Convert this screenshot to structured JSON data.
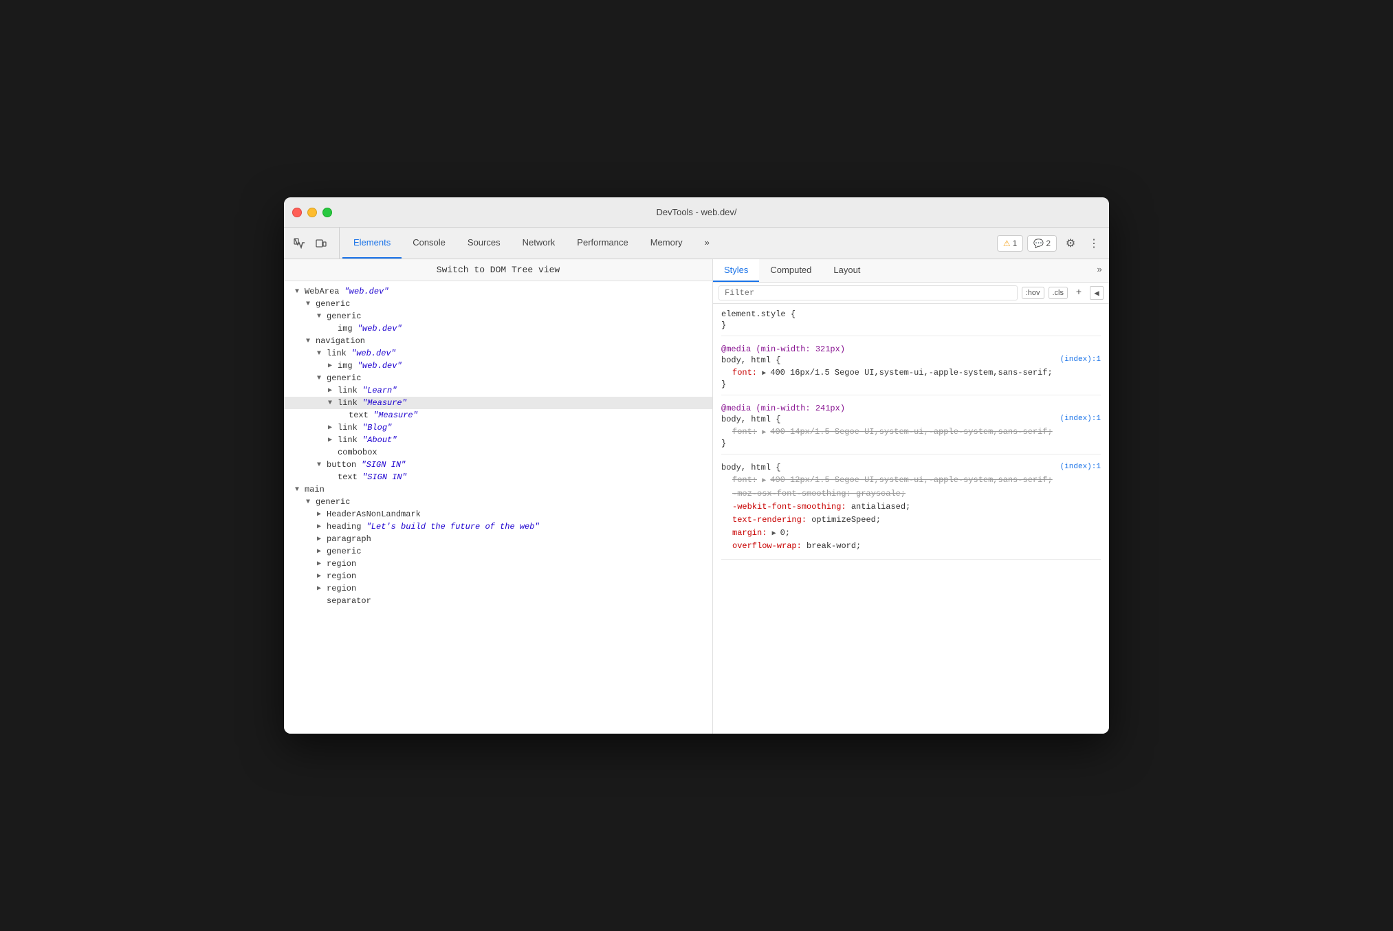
{
  "window": {
    "title": "DevTools - web.dev/"
  },
  "toolbar": {
    "tabs": [
      {
        "label": "Elements",
        "active": true
      },
      {
        "label": "Console",
        "active": false
      },
      {
        "label": "Sources",
        "active": false
      },
      {
        "label": "Network",
        "active": false
      },
      {
        "label": "Performance",
        "active": false
      },
      {
        "label": "Memory",
        "active": false
      }
    ],
    "more_label": "»",
    "warning_count": "1",
    "info_count": "2"
  },
  "dom_panel": {
    "switch_label": "Switch to DOM Tree view",
    "tree": [
      {
        "indent": 0,
        "arrow": "expanded",
        "label": "WebArea",
        "attr": "\"web.dev\""
      },
      {
        "indent": 1,
        "arrow": "expanded",
        "label": "generic"
      },
      {
        "indent": 2,
        "arrow": "expanded",
        "label": "generic"
      },
      {
        "indent": 3,
        "arrow": "leaf",
        "label": "img",
        "attr": "\"web.dev\""
      },
      {
        "indent": 1,
        "arrow": "expanded",
        "label": "navigation"
      },
      {
        "indent": 2,
        "arrow": "expanded",
        "label": "link",
        "attr": "\"web.dev\""
      },
      {
        "indent": 3,
        "arrow": "collapsed",
        "label": "img",
        "attr": "\"web.dev\""
      },
      {
        "indent": 2,
        "arrow": "expanded",
        "label": "generic"
      },
      {
        "indent": 3,
        "arrow": "collapsed",
        "label": "link",
        "attr": "\"Learn\""
      },
      {
        "indent": 3,
        "arrow": "expanded",
        "label": "link",
        "attr": "\"Measure\"",
        "selected": true
      },
      {
        "indent": 4,
        "arrow": "leaf",
        "label": "text",
        "attr": "\"Measure\""
      },
      {
        "indent": 3,
        "arrow": "collapsed",
        "label": "link",
        "attr": "\"Blog\""
      },
      {
        "indent": 3,
        "arrow": "collapsed",
        "label": "link",
        "attr": "\"About\""
      },
      {
        "indent": 3,
        "arrow": "leaf",
        "label": "combobox"
      },
      {
        "indent": 2,
        "arrow": "expanded",
        "label": "button",
        "attr": "\"SIGN IN\""
      },
      {
        "indent": 3,
        "arrow": "leaf",
        "label": "text",
        "attr": "\"SIGN IN\""
      },
      {
        "indent": 0,
        "arrow": "expanded",
        "label": "main"
      },
      {
        "indent": 1,
        "arrow": "expanded",
        "label": "generic"
      },
      {
        "indent": 2,
        "arrow": "collapsed",
        "label": "HeaderAsNonLandmark"
      },
      {
        "indent": 2,
        "arrow": "collapsed",
        "label": "heading",
        "attr": "\"Let's build the future of the web\""
      },
      {
        "indent": 2,
        "arrow": "collapsed",
        "label": "paragraph"
      },
      {
        "indent": 2,
        "arrow": "collapsed",
        "label": "generic"
      },
      {
        "indent": 2,
        "arrow": "collapsed",
        "label": "region"
      },
      {
        "indent": 2,
        "arrow": "collapsed",
        "label": "region"
      },
      {
        "indent": 2,
        "arrow": "collapsed",
        "label": "region"
      },
      {
        "indent": 2,
        "arrow": "leaf",
        "label": "separator"
      }
    ]
  },
  "styles_panel": {
    "tabs": [
      {
        "label": "Styles",
        "active": true
      },
      {
        "label": "Computed",
        "active": false
      },
      {
        "label": "Layout",
        "active": false
      }
    ],
    "filter_placeholder": "Filter",
    "pseudo_label": ":hov",
    "cls_label": ".cls",
    "blocks": [
      {
        "type": "element",
        "selector": "element.style {",
        "close": "}",
        "rules": []
      },
      {
        "type": "media",
        "media": "@media (min-width: 321px)",
        "selector": "body, html {",
        "source": "(index):1",
        "close": "}",
        "rules": [
          {
            "prop": "font:",
            "arrow": true,
            "val": "400 16px/1.5 Segoe UI,system-ui,-apple-system,sans-serif;",
            "strikethrough": false
          }
        ]
      },
      {
        "type": "media",
        "media": "@media (min-width: 241px)",
        "selector": "body, html {",
        "source": "(index):1",
        "close": "}",
        "rules": [
          {
            "prop": "font:",
            "arrow": true,
            "val": "400 14px/1.5 Segoe UI,system-ui,-apple-system,sans-serif;",
            "strikethrough": true
          }
        ]
      },
      {
        "type": "normal",
        "selector": "body, html {",
        "source": "(index):1",
        "close": "}",
        "rules": [
          {
            "prop": "font:",
            "arrow": true,
            "val": "400 12px/1.5 Segoe UI,system-ui,-apple-system,sans-serif;",
            "strikethrough": true
          },
          {
            "prop": "-moz-osx-font-smoothing:",
            "val": "grayscale;",
            "strikethrough": true
          },
          {
            "prop": "-webkit-font-smoothing:",
            "val": "antialiased;",
            "strikethrough": false,
            "webkit": true
          },
          {
            "prop": "text-rendering:",
            "val": "optimizeSpeed;",
            "strikethrough": false,
            "webkit": true
          },
          {
            "prop": "margin:",
            "arrow": true,
            "val": "0;",
            "strikethrough": false,
            "webkit": true
          },
          {
            "prop": "overflow-wrap:",
            "val": "break-word;",
            "strikethrough": false,
            "webkit": true,
            "partial": true
          }
        ]
      }
    ]
  }
}
